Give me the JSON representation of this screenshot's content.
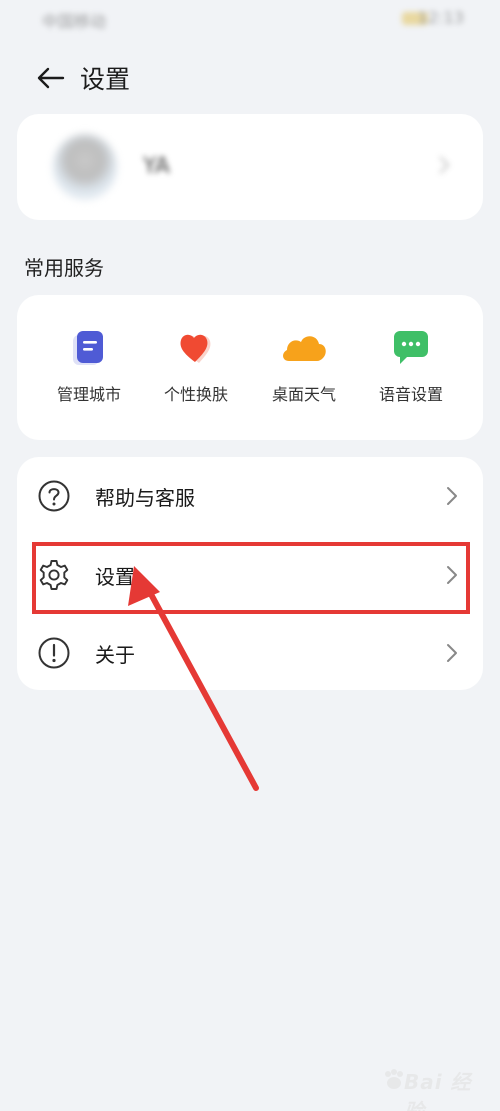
{
  "status_bar": {
    "carrier": "中国移动",
    "time": "12:13"
  },
  "header": {
    "title": "设置"
  },
  "profile": {
    "name": "YA"
  },
  "services": {
    "section_title": "常用服务",
    "items": [
      {
        "label": "管理城市",
        "icon": "document-icon",
        "color": "#4f5bd5"
      },
      {
        "label": "个性换肤",
        "icon": "heart-icon",
        "color": "#f04a32"
      },
      {
        "label": "桌面天气",
        "icon": "cloud-icon",
        "color": "#f7a21b"
      },
      {
        "label": "语音设置",
        "icon": "chat-bubble-icon",
        "color": "#3fbf67"
      }
    ]
  },
  "menu": {
    "items": [
      {
        "label": "帮助与客服",
        "icon": "question-circle-icon"
      },
      {
        "label": "设置",
        "icon": "gear-icon"
      },
      {
        "label": "关于",
        "icon": "info-circle-icon"
      }
    ]
  },
  "annotation": {
    "highlight_color": "#e53935"
  },
  "watermark": {
    "text": "Bai 经验"
  }
}
